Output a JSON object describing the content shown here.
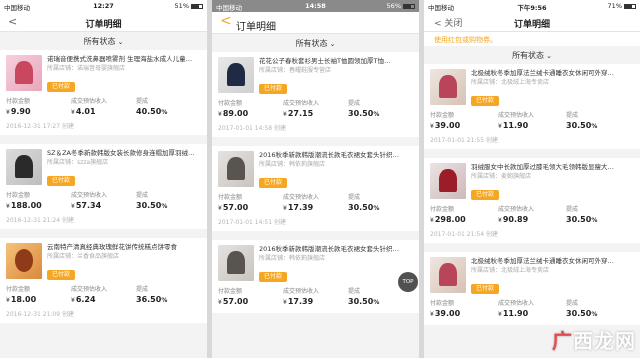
{
  "panels": [
    {
      "status": {
        "carrier": "中国移动",
        "time": "12:27",
        "battery": "51%"
      },
      "nav": {
        "back": "<",
        "title": "订单明细"
      },
      "filter": {
        "label": "所有状态"
      },
      "labels": {
        "paid": "付款金额",
        "income": "成交预估收入",
        "rate": "提成"
      },
      "orders": [
        {
          "name": "诺瑞音便携式洗鼻器喷雾剂 生理海盐水成人儿童…",
          "shop": "所属店铺：诺瑞音母婴旗舰店",
          "status": "已付款",
          "paid_cur": "¥",
          "paid": "9.90",
          "income_cur": "¥",
          "income": "4.01",
          "rate": "40.50",
          "rate_unit": "%",
          "date": "2016-12-31 17:27 创建"
        },
        {
          "name": "SZ＆ZA冬季新款韩版女装长款修身连帽加厚羽绒…",
          "shop": "所属店铺：szza旗舰店",
          "status": "已付款",
          "paid_cur": "¥",
          "paid": "188.00",
          "income_cur": "¥",
          "income": "57.34",
          "rate": "30.50",
          "rate_unit": "%",
          "date": "2016-12-31 21:24 创建"
        },
        {
          "name": "云南特产清真经典玫瑰鲜花饼传统糕点饼零食",
          "shop": "所属店铺：兰香食品旗舰店",
          "status": "已付款",
          "paid_cur": "¥",
          "paid": "18.00",
          "income_cur": "¥",
          "income": "6.24",
          "rate": "36.50",
          "rate_unit": "%",
          "date": "2016-12-31 21:09 创建"
        }
      ]
    },
    {
      "status": {
        "carrier": "中国移动",
        "time": "14:58",
        "battery": "56%"
      },
      "nav": {
        "back": "<",
        "title": "订单明细"
      },
      "filter": {
        "label": "所有状态"
      },
      "labels": {
        "paid": "付款金额",
        "income": "成交预估收入",
        "rate": "提成"
      },
      "orders": [
        {
          "name": "花花公子春秋套衫男士长袖T恤圆领加厚T恤…",
          "shop": "所属店铺：春耀鞋服专营店",
          "status": "已付款",
          "paid_cur": "¥",
          "paid": "89.00",
          "income_cur": "¥",
          "income": "27.15",
          "rate": "30.50",
          "rate_unit": "%",
          "date": "2017-01-01 14:58 创建"
        },
        {
          "name": "2016秋季新款韩版潮流长款毛衣裙女套头针织…",
          "shop": "所属店铺：韩依莉旗舰店",
          "status": "已付款",
          "paid_cur": "¥",
          "paid": "57.00",
          "income_cur": "¥",
          "income": "17.39",
          "rate": "30.50",
          "rate_unit": "%",
          "date": "2017-01-01 14:51 创建"
        },
        {
          "name": "2016秋季新款韩版潮流长款毛衣裙女套头针织…",
          "shop": "所属店铺：韩依莉旗舰店",
          "status": "已付款",
          "paid_cur": "¥",
          "paid": "57.00",
          "income_cur": "¥",
          "income": "17.39",
          "rate": "30.50",
          "rate_unit": "%",
          "date": ""
        }
      ],
      "top_button": "TOP"
    },
    {
      "status": {
        "carrier": "中国移动",
        "time": "下午9:56",
        "battery": "71%"
      },
      "nav": {
        "back": "< 关闭",
        "title": "订单明细"
      },
      "notice": "使用红包或购物券。",
      "filter": {
        "label": "所有状态"
      },
      "labels": {
        "paid": "付款金额",
        "income": "成交预估收入",
        "rate": "提成"
      },
      "orders": [
        {
          "name": "北极绒秋冬季加厚法兰绒卡通睡衣女休闲可外穿…",
          "shop": "所属店铺：北极绒上海专卖店",
          "status": "已付款",
          "paid_cur": "¥",
          "paid": "39.00",
          "income_cur": "¥",
          "income": "11.90",
          "rate": "30.50",
          "rate_unit": "%",
          "date": "2017-01-01 21:55 创建"
        },
        {
          "name": "羽绒服女中长款加厚过膝毛领大毛领韩版显瘦大…",
          "shop": "所属店铺：麦朝旗舰店",
          "status": "已付款",
          "paid_cur": "¥",
          "paid": "298.00",
          "income_cur": "¥",
          "income": "90.89",
          "rate": "30.50",
          "rate_unit": "%",
          "date": "2017-01-01 21:54 创建"
        },
        {
          "name": "北极绒秋冬季加厚法兰绒卡通睡衣女休闲可外穿…",
          "shop": "所属店铺：北极绒上海专卖店",
          "status": "已付款",
          "paid_cur": "¥",
          "paid": "39.00",
          "income_cur": "¥",
          "income": "11.90",
          "rate": "30.50",
          "rate_unit": "%",
          "date": ""
        }
      ]
    }
  ],
  "watermark": {
    "a": "广",
    "b": "西龙网"
  }
}
